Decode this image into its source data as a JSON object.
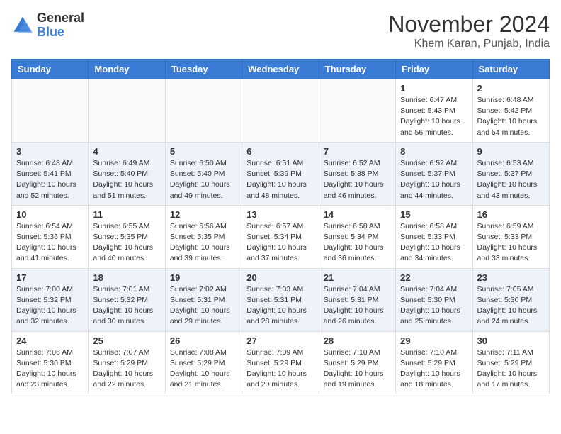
{
  "header": {
    "logo": {
      "general": "General",
      "blue": "Blue"
    },
    "title": "November 2024",
    "location": "Khem Karan, Punjab, India"
  },
  "weekdays": [
    "Sunday",
    "Monday",
    "Tuesday",
    "Wednesday",
    "Thursday",
    "Friday",
    "Saturday"
  ],
  "weeks": [
    [
      {
        "day": "",
        "info": ""
      },
      {
        "day": "",
        "info": ""
      },
      {
        "day": "",
        "info": ""
      },
      {
        "day": "",
        "info": ""
      },
      {
        "day": "",
        "info": ""
      },
      {
        "day": "1",
        "info": "Sunrise: 6:47 AM\nSunset: 5:43 PM\nDaylight: 10 hours\nand 56 minutes."
      },
      {
        "day": "2",
        "info": "Sunrise: 6:48 AM\nSunset: 5:42 PM\nDaylight: 10 hours\nand 54 minutes."
      }
    ],
    [
      {
        "day": "3",
        "info": "Sunrise: 6:48 AM\nSunset: 5:41 PM\nDaylight: 10 hours\nand 52 minutes."
      },
      {
        "day": "4",
        "info": "Sunrise: 6:49 AM\nSunset: 5:40 PM\nDaylight: 10 hours\nand 51 minutes."
      },
      {
        "day": "5",
        "info": "Sunrise: 6:50 AM\nSunset: 5:40 PM\nDaylight: 10 hours\nand 49 minutes."
      },
      {
        "day": "6",
        "info": "Sunrise: 6:51 AM\nSunset: 5:39 PM\nDaylight: 10 hours\nand 48 minutes."
      },
      {
        "day": "7",
        "info": "Sunrise: 6:52 AM\nSunset: 5:38 PM\nDaylight: 10 hours\nand 46 minutes."
      },
      {
        "day": "8",
        "info": "Sunrise: 6:52 AM\nSunset: 5:37 PM\nDaylight: 10 hours\nand 44 minutes."
      },
      {
        "day": "9",
        "info": "Sunrise: 6:53 AM\nSunset: 5:37 PM\nDaylight: 10 hours\nand 43 minutes."
      }
    ],
    [
      {
        "day": "10",
        "info": "Sunrise: 6:54 AM\nSunset: 5:36 PM\nDaylight: 10 hours\nand 41 minutes."
      },
      {
        "day": "11",
        "info": "Sunrise: 6:55 AM\nSunset: 5:35 PM\nDaylight: 10 hours\nand 40 minutes."
      },
      {
        "day": "12",
        "info": "Sunrise: 6:56 AM\nSunset: 5:35 PM\nDaylight: 10 hours\nand 39 minutes."
      },
      {
        "day": "13",
        "info": "Sunrise: 6:57 AM\nSunset: 5:34 PM\nDaylight: 10 hours\nand 37 minutes."
      },
      {
        "day": "14",
        "info": "Sunrise: 6:58 AM\nSunset: 5:34 PM\nDaylight: 10 hours\nand 36 minutes."
      },
      {
        "day": "15",
        "info": "Sunrise: 6:58 AM\nSunset: 5:33 PM\nDaylight: 10 hours\nand 34 minutes."
      },
      {
        "day": "16",
        "info": "Sunrise: 6:59 AM\nSunset: 5:33 PM\nDaylight: 10 hours\nand 33 minutes."
      }
    ],
    [
      {
        "day": "17",
        "info": "Sunrise: 7:00 AM\nSunset: 5:32 PM\nDaylight: 10 hours\nand 32 minutes."
      },
      {
        "day": "18",
        "info": "Sunrise: 7:01 AM\nSunset: 5:32 PM\nDaylight: 10 hours\nand 30 minutes."
      },
      {
        "day": "19",
        "info": "Sunrise: 7:02 AM\nSunset: 5:31 PM\nDaylight: 10 hours\nand 29 minutes."
      },
      {
        "day": "20",
        "info": "Sunrise: 7:03 AM\nSunset: 5:31 PM\nDaylight: 10 hours\nand 28 minutes."
      },
      {
        "day": "21",
        "info": "Sunrise: 7:04 AM\nSunset: 5:31 PM\nDaylight: 10 hours\nand 26 minutes."
      },
      {
        "day": "22",
        "info": "Sunrise: 7:04 AM\nSunset: 5:30 PM\nDaylight: 10 hours\nand 25 minutes."
      },
      {
        "day": "23",
        "info": "Sunrise: 7:05 AM\nSunset: 5:30 PM\nDaylight: 10 hours\nand 24 minutes."
      }
    ],
    [
      {
        "day": "24",
        "info": "Sunrise: 7:06 AM\nSunset: 5:30 PM\nDaylight: 10 hours\nand 23 minutes."
      },
      {
        "day": "25",
        "info": "Sunrise: 7:07 AM\nSunset: 5:29 PM\nDaylight: 10 hours\nand 22 minutes."
      },
      {
        "day": "26",
        "info": "Sunrise: 7:08 AM\nSunset: 5:29 PM\nDaylight: 10 hours\nand 21 minutes."
      },
      {
        "day": "27",
        "info": "Sunrise: 7:09 AM\nSunset: 5:29 PM\nDaylight: 10 hours\nand 20 minutes."
      },
      {
        "day": "28",
        "info": "Sunrise: 7:10 AM\nSunset: 5:29 PM\nDaylight: 10 hours\nand 19 minutes."
      },
      {
        "day": "29",
        "info": "Sunrise: 7:10 AM\nSunset: 5:29 PM\nDaylight: 10 hours\nand 18 minutes."
      },
      {
        "day": "30",
        "info": "Sunrise: 7:11 AM\nSunset: 5:29 PM\nDaylight: 10 hours\nand 17 minutes."
      }
    ]
  ]
}
